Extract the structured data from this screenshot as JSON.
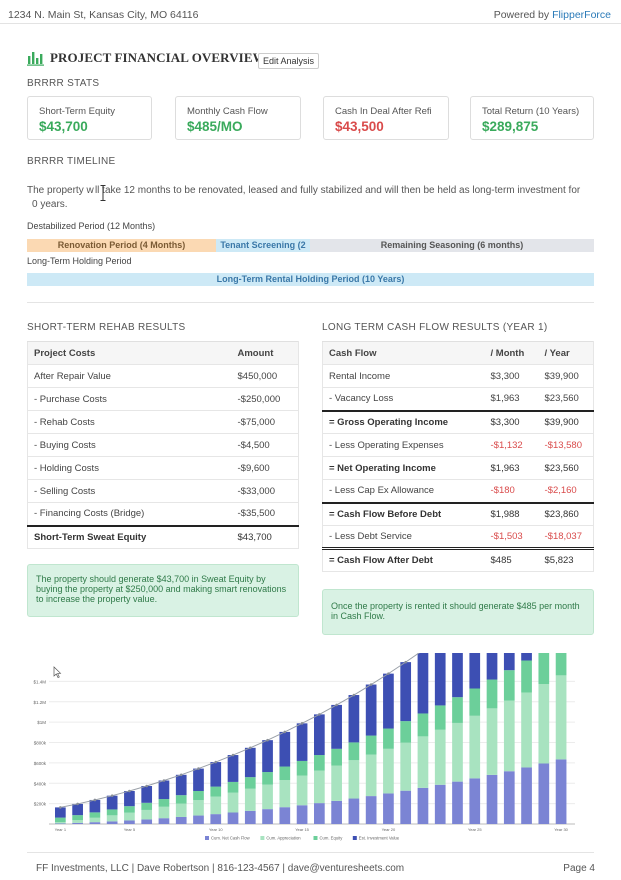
{
  "header": {
    "address": "1234 N. Main St, Kansas City, MO 64116",
    "powered_by": "Powered by",
    "brand": "FlipperForce"
  },
  "title": "PROJECT FINANCIAL OVERVIEW",
  "edit_button": "Edit Analysis",
  "stats_title": "BRRRR STATS",
  "stats": [
    {
      "label": "Short-Term Equity",
      "value": "$43,700",
      "color": "#3aaa5c"
    },
    {
      "label": "Monthly Cash Flow",
      "value": "$485/MO",
      "color": "#3aaa5c"
    },
    {
      "label": "Cash In Deal After Refi",
      "value": "$43,500",
      "color": "#d94b4b"
    },
    {
      "label": "Total Return (10 Years)",
      "value": "$289,875",
      "color": "#3aaa5c"
    }
  ],
  "timeline": {
    "title": "BRRRR TIMELINE",
    "text_before": "The property w",
    "text_after": "ll take 12 months to be renovated, leased and fully stabilized and will then be held as long-term investment for ",
    "text_end": "0 years.",
    "destabilized_label": "Destabilized Period (12 Months)",
    "renovation": "Renovation Period (4 Months)",
    "screening": "Tenant Screening (2",
    "seasoning": "Remaining Seasoning (6 months)",
    "holding_label": "Long-Term Holding Period",
    "holding_bar": "Long-Term Rental Holding Period (10 Years)"
  },
  "rehab": {
    "title": "SHORT-TERM REHAB RESULTS",
    "headers": [
      "Project Costs",
      "Amount"
    ],
    "rows": [
      [
        "After Repair Value",
        "$450,000"
      ],
      [
        "- Purchase Costs",
        "-$250,000"
      ],
      [
        "- Rehab Costs",
        "-$75,000"
      ],
      [
        "- Buying Costs",
        "-$4,500"
      ],
      [
        "- Holding Costs",
        "-$9,600"
      ],
      [
        "- Selling Costs",
        "-$33,000"
      ],
      [
        "- Financing Costs (Bridge)",
        "-$35,500"
      ]
    ],
    "total": [
      "Short-Term Sweat Equity",
      "$43,700"
    ],
    "note": "The property should generate $43,700 in Sweat Equity by buying the property at $250,000 and making smart renovations to increase the property value."
  },
  "cashflow": {
    "title": "LONG TERM CASH FLOW RESULTS (YEAR 1)",
    "headers": [
      "Cash Flow",
      "/ Month",
      "/ Year"
    ],
    "rows": [
      {
        "label": "Rental Income",
        "month": "$3,300",
        "year": "$39,900",
        "style": "normal"
      },
      {
        "label": "- Vacancy Loss",
        "month": "$1,963",
        "year": "$23,560",
        "style": "normal"
      },
      {
        "label": "= Gross Operating Income",
        "month": "$3,300",
        "year": "$39,900",
        "style": "total"
      },
      {
        "label": "- Less Operating Expenses",
        "month": "-$1,132",
        "year": "-$13,580",
        "style": "neg"
      },
      {
        "label": "= Net Operating Income",
        "month": "$1,963",
        "year": "$23,560",
        "style": "bold"
      },
      {
        "label": "- Less Cap Ex Allowance",
        "month": "-$180",
        "year": "-$2,160",
        "style": "neg"
      },
      {
        "label": "= Cash Flow Before Debt",
        "month": "$1,988",
        "year": "$23,860",
        "style": "total"
      },
      {
        "label": "- Less Debt Service",
        "month": "-$1,503",
        "year": "-$18,037",
        "style": "neg"
      },
      {
        "label": "= Cash Flow After Debt",
        "month": "$485",
        "year": "$5,823",
        "style": "final"
      }
    ],
    "note": "Once the property is rented it should generate $485 per month in Cash Flow."
  },
  "chart_data": {
    "type": "bar",
    "stacked": true,
    "ylim": [
      0,
      1600000
    ],
    "y_ticks": [
      "$200k",
      "$400k",
      "$600k",
      "$800k",
      "$1M",
      "$1.2M",
      "$1.4M"
    ],
    "x_ticks": [
      "Year 1",
      "Year 5",
      "Year 10",
      "Year 15",
      "Year 20",
      "Year 25",
      "Year 30"
    ],
    "categories": [
      1,
      2,
      3,
      4,
      5,
      6,
      7,
      8,
      9,
      10,
      11,
      12,
      13,
      14,
      15,
      16,
      17,
      18,
      19,
      20,
      21,
      22,
      23,
      24,
      25,
      26,
      27,
      28,
      29,
      30
    ],
    "series": [
      {
        "name": "Cum. Net Cash Flow",
        "color": "#7b84d4",
        "values": [
          5,
          11,
          18,
          26,
          35,
          45,
          57,
          69,
          83,
          97,
          113,
          129,
          146,
          165,
          184,
          205,
          227,
          250,
          274,
          300,
          327,
          355,
          385,
          416,
          448,
          482,
          518,
          555,
          594,
          634
        ]
      },
      {
        "name": "Cum. Appreciation",
        "color": "#a8e3c0",
        "values": [
          14,
          28,
          43,
          59,
          76,
          93,
          112,
          131,
          151,
          172,
          194,
          217,
          241,
          266,
          292,
          319,
          347,
          376,
          407,
          438,
          471,
          505,
          540,
          576,
          614,
          653,
          694,
          736,
          780,
          825
        ]
      },
      {
        "name": "Cum. Equity",
        "color": "#6ccf9a",
        "values": [
          44,
          48,
          53,
          58,
          64,
          70,
          76,
          83,
          90,
          98,
          106,
          114,
          123,
          133,
          143,
          153,
          164,
          175,
          187,
          199,
          212,
          225,
          239,
          253,
          268,
          283,
          298,
          314,
          330,
          347
        ]
      },
      {
        "name": "Est. Investment Value",
        "color": "#3d4fb3",
        "values": [
          100,
          110,
          122,
          135,
          149,
          165,
          182,
          200,
          220,
          241,
          264,
          288,
          313,
          340,
          369,
          399,
          431,
          465,
          501,
          539,
          579,
          621,
          665,
          711,
          760,
          811,
          864,
          920,
          978,
          1039
        ]
      }
    ],
    "legend": "bottom",
    "grid": true
  },
  "footer": {
    "contact": "FF Investments, LLC | Dave Robertson | 816-123-4567 | dave@venturesheets.com",
    "page": "Page 4"
  }
}
